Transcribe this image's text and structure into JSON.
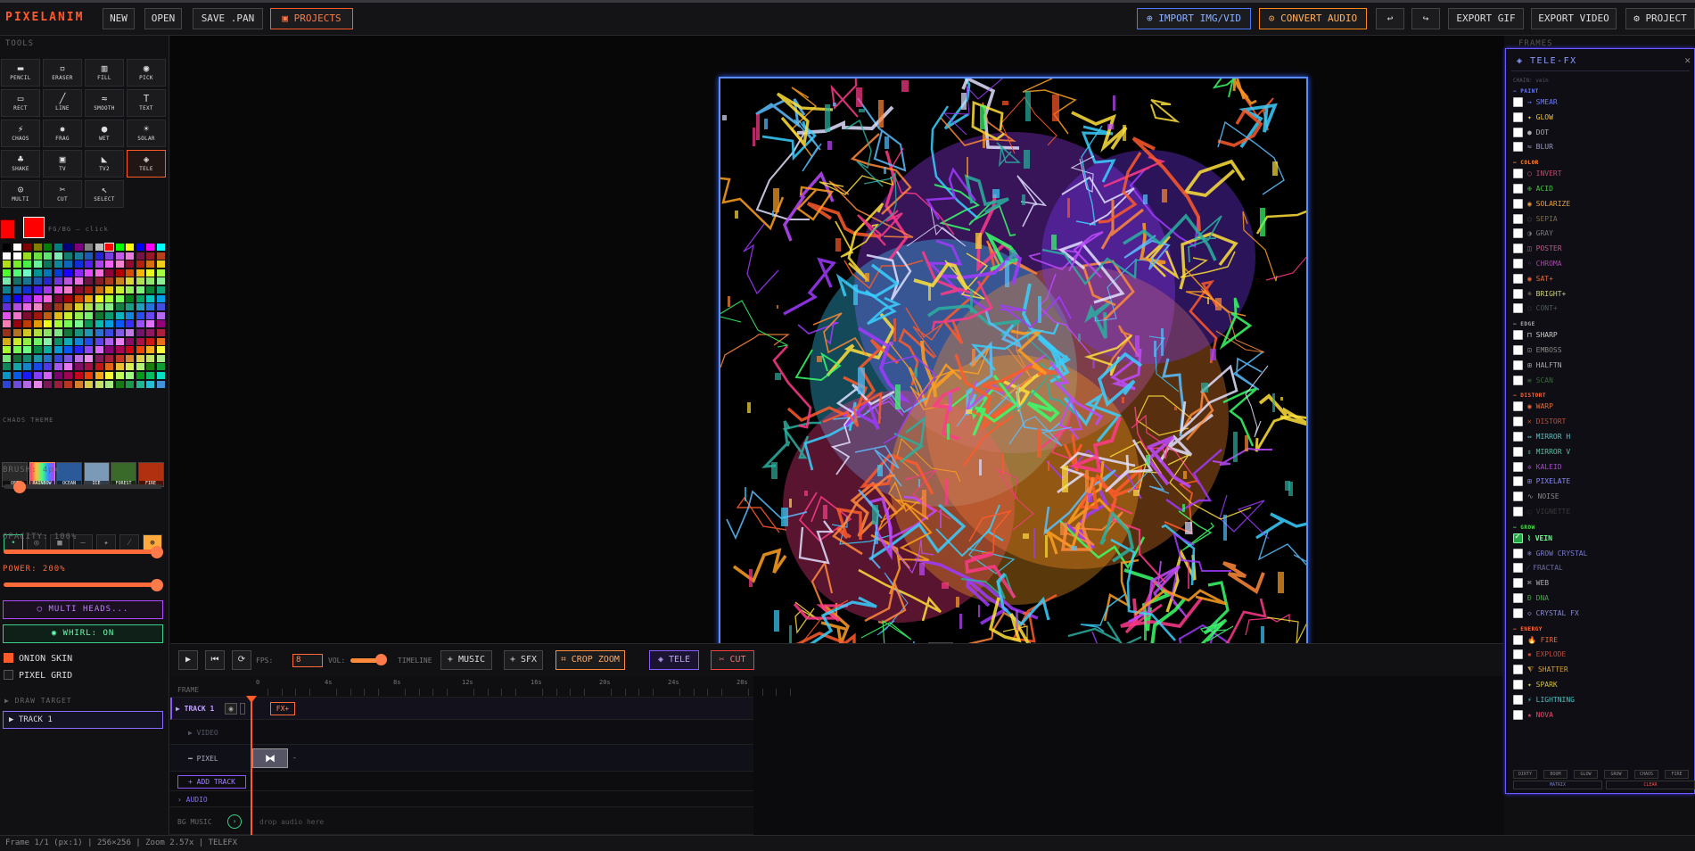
{
  "app": {
    "title": "PIXELANIM"
  },
  "topbar": {
    "new": "NEW",
    "open": "OPEN",
    "save": "SAVE .PAN",
    "projects": "PROJECTS",
    "import": "IMPORT IMG/VID",
    "convert_audio": "CONVERT AUDIO",
    "undo_icon": "↩",
    "redo_icon": "↪",
    "export_gif": "EXPORT GIF",
    "export_video": "EXPORT VIDEO",
    "project": "PROJECT"
  },
  "tools": {
    "title": "TOOLS",
    "items": [
      {
        "icon": "▬",
        "label": "PENCIL"
      },
      {
        "icon": "▫",
        "label": "ERASER"
      },
      {
        "icon": "▥",
        "label": "FILL"
      },
      {
        "icon": "◉",
        "label": "PICK"
      },
      {
        "icon": "▭",
        "label": "RECT"
      },
      {
        "icon": "╱",
        "label": "LINE"
      },
      {
        "icon": "≈",
        "label": "SMOOTH"
      },
      {
        "icon": "T",
        "label": "TEXT"
      },
      {
        "icon": "⚡",
        "label": "CHAOS"
      },
      {
        "icon": "✸",
        "label": "FRAG"
      },
      {
        "icon": "●",
        "label": "WET"
      },
      {
        "icon": "☀",
        "label": "SOLAR"
      },
      {
        "icon": "♣",
        "label": "SHAKE"
      },
      {
        "icon": "▣",
        "label": "TV"
      },
      {
        "icon": "◣",
        "label": "TV2"
      },
      {
        "icon": "◈",
        "label": "TELE"
      },
      {
        "icon": "⊙",
        "label": "MULTI"
      },
      {
        "icon": "✂",
        "label": "CUT"
      },
      {
        "icon": "↖",
        "label": "SELECT"
      }
    ],
    "active_index": 15
  },
  "colors": {
    "fg": "#ff0000",
    "bg": "#ff0000",
    "fgbg_label": "FG/BG — click",
    "palette": [
      "#000000",
      "#ffffff",
      "#7f0000",
      "#7f7f00",
      "#007f00",
      "#007f7f",
      "#00007f",
      "#7f007f",
      "#7f7f7f",
      "#bfbfbf",
      "#ff0000",
      "#00ff00",
      "#ffff00",
      "#0000ff",
      "#ff00ff",
      "#00ffff"
    ]
  },
  "chaos_theme": {
    "title": "CHAOS THEME",
    "themes": [
      {
        "label": "OFF",
        "color": "#2a2a2a"
      },
      {
        "label": "RAINBOW",
        "color": "#d04cb0"
      },
      {
        "label": "OCEAN",
        "color": "#2a5a9a"
      },
      {
        "label": "ICE",
        "color": "#7a9ab8"
      },
      {
        "label": "FOREST",
        "color": "#3a6a2a"
      },
      {
        "label": "FIRE",
        "color": "#b03010"
      }
    ]
  },
  "brush": {
    "label": "BRUSH: 4px",
    "value": 4,
    "max": 64
  },
  "brush_shapes": [
    "•",
    "◎",
    "■",
    "–",
    "✦",
    "⁄",
    "⊛"
  ],
  "opacity": {
    "label": "OPACITY: 100%",
    "value": 100
  },
  "power": {
    "label": "POWER: 200%",
    "value": 200
  },
  "multi_heads": "◯ MULTI HEADS...",
  "whirl": "◉ WHIRL: ON",
  "onion_skin": "ONION SKIN",
  "pixel_grid": "PIXEL GRID",
  "draw_target": {
    "title": "▶ DRAW TARGET",
    "value": "▶ TRACK 1"
  },
  "timeline_bar": {
    "play_icon": "▶",
    "rewind_icon": "⏮",
    "loop_icon": "⟳",
    "fps_label": "FPS:",
    "fps_value": "8",
    "vol_label": "VOL:",
    "timeline_label": "TIMELINE",
    "music": "+ MUSIC",
    "sfx": "+ SFX",
    "crop_zoom": "⌗ CROP ZOOM",
    "tele": "◈ TELE",
    "cut": "✂ CUT"
  },
  "timeline": {
    "frame_label": "FRAME",
    "ruler": [
      "0",
      "4s",
      "8s",
      "12s",
      "16s",
      "20s",
      "24s",
      "28s"
    ],
    "track1": "▶ TRACK 1",
    "fx_badge": "FX+",
    "video": "▶ VIDEO",
    "pixel": "━ PIXEL",
    "add_track": "+ ADD TRACK",
    "audio": "› AUDIO",
    "bg_music": "BG MUSIC",
    "drop_audio": "drop audio here"
  },
  "status": "Frame 1/1 (px:1) | 256×256 | Zoom 2.57x | TELEFX",
  "frames_panel": {
    "title": "FRAMES"
  },
  "telefx": {
    "title": "◈ TELE-FX",
    "chain": "CHAIN: vein",
    "categories": [
      {
        "name": "PAINT",
        "color": "#6a7aff",
        "items": [
          {
            "label": "→ SMEAR",
            "color": "#6a7aff",
            "on": false
          },
          {
            "label": "✦ GLOW",
            "color": "#e8c040",
            "on": false
          },
          {
            "label": "● DOT",
            "color": "#aaaaaa",
            "on": false
          },
          {
            "label": "≈ BLUR",
            "color": "#9a9ab8",
            "on": false
          }
        ]
      },
      {
        "name": "COLOR",
        "color": "#ff8a3a",
        "items": [
          {
            "label": "◯ INVERT",
            "color": "#c04a6a",
            "on": false
          },
          {
            "label": "⊕ ACID",
            "color": "#4ac04a",
            "on": false
          },
          {
            "label": "◉ SOLARIZE",
            "color": "#e8a040",
            "on": false
          },
          {
            "label": "◌ SEPIA",
            "color": "#7a6a4a",
            "on": false
          },
          {
            "label": "◑ GRAY",
            "color": "#777777",
            "on": false
          },
          {
            "label": "◫ POSTER",
            "color": "#c05a8a",
            "on": false
          },
          {
            "label": "◦ CHROMA",
            "color": "#a04aa0",
            "on": false
          },
          {
            "label": "◉ SAT+",
            "color": "#e06a3a",
            "on": false
          },
          {
            "label": "☼ BRIGHT+",
            "color": "#d0d080",
            "on": false
          },
          {
            "label": "◌ CONT+",
            "color": "#4a5a5a",
            "on": false
          }
        ]
      },
      {
        "name": "EDGE",
        "color": "#aaaaaa",
        "items": [
          {
            "label": "⊓ SHARP",
            "color": "#cccccc",
            "on": false
          },
          {
            "label": "⊡ EMBOSS",
            "color": "#888888",
            "on": false
          },
          {
            "label": "⊞ HALFTN",
            "color": "#aaaaaa",
            "on": false
          },
          {
            "label": "≡ SCAN",
            "color": "#3a6a3a",
            "on": false
          }
        ]
      },
      {
        "name": "DISTORT",
        "color": "#ff6a3a",
        "items": [
          {
            "label": "◉ WARP",
            "color": "#e06a3a",
            "on": false
          },
          {
            "label": "✕ DISTORT",
            "color": "#c04a3a",
            "on": false
          },
          {
            "label": "⇔ MIRROR H",
            "color": "#5ac0c0",
            "on": false
          },
          {
            "label": "⇕ MIRROR V",
            "color": "#5ac0a0",
            "on": false
          },
          {
            "label": "✲ KALEID",
            "color": "#a04ac0",
            "on": false
          },
          {
            "label": "⊞ PIXELATE",
            "color": "#8a8aff",
            "on": false
          },
          {
            "label": "∿ NOISE",
            "color": "#888888",
            "on": false
          },
          {
            "label": "◌ VIGNETTE",
            "color": "#3a3a3a",
            "on": false
          }
        ]
      },
      {
        "name": "GROW",
        "color": "#4ae04a",
        "items": [
          {
            "label": "⌇ VEIN",
            "color": "#6aff8a",
            "on": true
          },
          {
            "label": "❄ GROW CRYSTAL",
            "color": "#7a7acc",
            "on": false
          },
          {
            "label": "⁄ FRACTAL",
            "color": "#6a6a9a",
            "on": false
          },
          {
            "label": "⌘ WEB",
            "color": "#aaaaaa",
            "on": false
          },
          {
            "label": "Ɖ DNA",
            "color": "#4aa04a",
            "on": false
          },
          {
            "label": "◇ CRYSTAL FX",
            "color": "#8a8acc",
            "on": false
          }
        ]
      },
      {
        "name": "ENERGY",
        "color": "#ff6a3a",
        "items": [
          {
            "label": "🔥 FIRE",
            "color": "#e06a3a",
            "on": false
          },
          {
            "label": "✹ EXPLODE",
            "color": "#c04a3a",
            "on": false
          },
          {
            "label": "⧨ SHATTER",
            "color": "#d0a040",
            "on": false
          },
          {
            "label": "✦ SPARK",
            "color": "#d0c040",
            "on": false
          },
          {
            "label": "⚡ LIGHTNING",
            "color": "#4ac0c0",
            "on": false
          },
          {
            "label": "★ NOVA",
            "color": "#e04a6a",
            "on": false
          }
        ]
      }
    ],
    "presets": [
      "DIRTY",
      "BOOM",
      "GLOW",
      "GROW",
      "CHAOS",
      "FIRE"
    ],
    "matrix": "MATRIX",
    "clear": "CLEAR"
  }
}
